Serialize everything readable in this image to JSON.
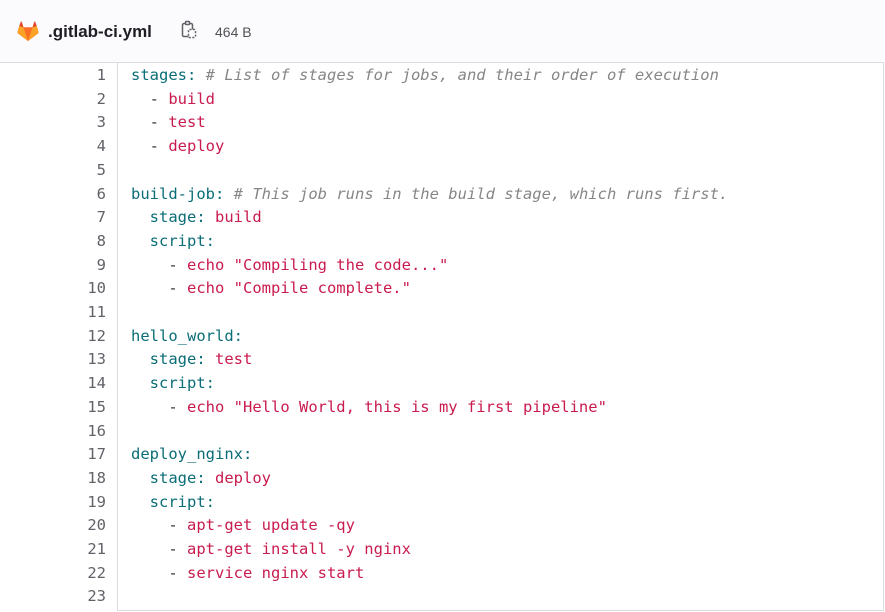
{
  "header": {
    "file_name": ".gitlab-ci.yml",
    "file_size": "464 B",
    "file_icon": "gitlab-tanuki-icon",
    "copy_icon": "copy-to-clipboard-icon"
  },
  "colors": {
    "key": "#0b6d77",
    "value": "#c91b4e",
    "comment": "#868686",
    "line_number": "#626168"
  },
  "code_lines": [
    {
      "n": "1",
      "tokens": [
        {
          "t": "stages:",
          "c": "key"
        },
        {
          "t": " ",
          "c": "plain"
        },
        {
          "t": "# List of stages for jobs, and their order of execution",
          "c": "com"
        }
      ]
    },
    {
      "n": "2",
      "tokens": [
        {
          "t": "  - ",
          "c": "plain"
        },
        {
          "t": "build",
          "c": "val"
        }
      ]
    },
    {
      "n": "3",
      "tokens": [
        {
          "t": "  - ",
          "c": "plain"
        },
        {
          "t": "test",
          "c": "val"
        }
      ]
    },
    {
      "n": "4",
      "tokens": [
        {
          "t": "  - ",
          "c": "plain"
        },
        {
          "t": "deploy",
          "c": "val"
        }
      ]
    },
    {
      "n": "5",
      "tokens": []
    },
    {
      "n": "6",
      "tokens": [
        {
          "t": "build-job:",
          "c": "key"
        },
        {
          "t": " ",
          "c": "plain"
        },
        {
          "t": "# This job runs in the build stage, which runs first.",
          "c": "com"
        }
      ]
    },
    {
      "n": "7",
      "tokens": [
        {
          "t": "  ",
          "c": "plain"
        },
        {
          "t": "stage:",
          "c": "key"
        },
        {
          "t": " ",
          "c": "plain"
        },
        {
          "t": "build",
          "c": "val"
        }
      ]
    },
    {
      "n": "8",
      "tokens": [
        {
          "t": "  ",
          "c": "plain"
        },
        {
          "t": "script:",
          "c": "key"
        }
      ]
    },
    {
      "n": "9",
      "tokens": [
        {
          "t": "    - ",
          "c": "plain"
        },
        {
          "t": "echo \"Compiling the code...\"",
          "c": "val"
        }
      ]
    },
    {
      "n": "10",
      "tokens": [
        {
          "t": "    - ",
          "c": "plain"
        },
        {
          "t": "echo \"Compile complete.\"",
          "c": "val"
        }
      ]
    },
    {
      "n": "11",
      "tokens": []
    },
    {
      "n": "12",
      "tokens": [
        {
          "t": "hello_world:",
          "c": "key"
        }
      ]
    },
    {
      "n": "13",
      "tokens": [
        {
          "t": "  ",
          "c": "plain"
        },
        {
          "t": "stage:",
          "c": "key"
        },
        {
          "t": " ",
          "c": "plain"
        },
        {
          "t": "test",
          "c": "val"
        }
      ]
    },
    {
      "n": "14",
      "tokens": [
        {
          "t": "  ",
          "c": "plain"
        },
        {
          "t": "script:",
          "c": "key"
        }
      ]
    },
    {
      "n": "15",
      "tokens": [
        {
          "t": "    - ",
          "c": "plain"
        },
        {
          "t": "echo \"Hello World, this is my first pipeline\"",
          "c": "val"
        }
      ]
    },
    {
      "n": "16",
      "tokens": []
    },
    {
      "n": "17",
      "tokens": [
        {
          "t": "deploy_nginx:",
          "c": "key"
        }
      ]
    },
    {
      "n": "18",
      "tokens": [
        {
          "t": "  ",
          "c": "plain"
        },
        {
          "t": "stage:",
          "c": "key"
        },
        {
          "t": " ",
          "c": "plain"
        },
        {
          "t": "deploy",
          "c": "val"
        }
      ]
    },
    {
      "n": "19",
      "tokens": [
        {
          "t": "  ",
          "c": "plain"
        },
        {
          "t": "script:",
          "c": "key"
        }
      ]
    },
    {
      "n": "20",
      "tokens": [
        {
          "t": "    - ",
          "c": "plain"
        },
        {
          "t": "apt-get update -qy",
          "c": "val"
        }
      ]
    },
    {
      "n": "21",
      "tokens": [
        {
          "t": "    - ",
          "c": "plain"
        },
        {
          "t": "apt-get install -y nginx",
          "c": "val"
        }
      ]
    },
    {
      "n": "22",
      "tokens": [
        {
          "t": "    - ",
          "c": "plain"
        },
        {
          "t": "service nginx start",
          "c": "val"
        }
      ]
    },
    {
      "n": "23",
      "tokens": []
    }
  ]
}
